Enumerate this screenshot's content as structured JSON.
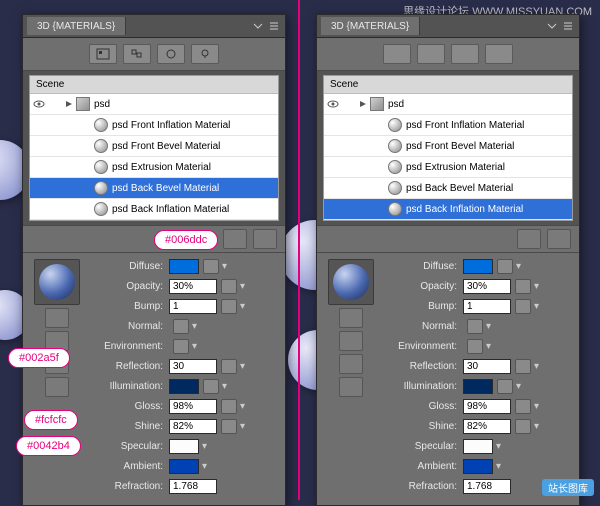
{
  "watermark": "思缘设计论坛 WWW.MISSYUAN.COM",
  "bottom_mark": "站长图库",
  "tab_title": "3D {MATERIALS}",
  "scene_label": "Scene",
  "root_name": "psd",
  "materials": [
    "psd Front Inflation Material",
    "psd Front Bevel Material",
    "psd Extrusion Material",
    "psd Back Bevel Material",
    "psd Back Inflation Material"
  ],
  "left_selected_index": 3,
  "right_selected_index": 4,
  "props": {
    "diffuse": {
      "label": "Diffuse:",
      "color": "#006ddc"
    },
    "opacity": {
      "label": "Opacity:",
      "value": "30%"
    },
    "bump": {
      "label": "Bump:",
      "value": "1"
    },
    "normal": {
      "label": "Normal:"
    },
    "environment": {
      "label": "Environment:"
    },
    "reflection": {
      "label": "Reflection:",
      "value": "30"
    },
    "illumination": {
      "label": "Illumination:",
      "color": "#002a5f"
    },
    "gloss": {
      "label": "Gloss:",
      "value": "98%"
    },
    "shine": {
      "label": "Shine:",
      "value": "82%"
    },
    "specular": {
      "label": "Specular:",
      "color": "#fcfcfc"
    },
    "ambient": {
      "label": "Ambient:",
      "color": "#0042b4"
    },
    "refraction": {
      "label": "Refraction:",
      "value": "1.768"
    }
  },
  "callouts": {
    "c1": "#006ddc",
    "c2": "#002a5f",
    "c3": "#fcfcfc",
    "c4": "#0042b4"
  }
}
